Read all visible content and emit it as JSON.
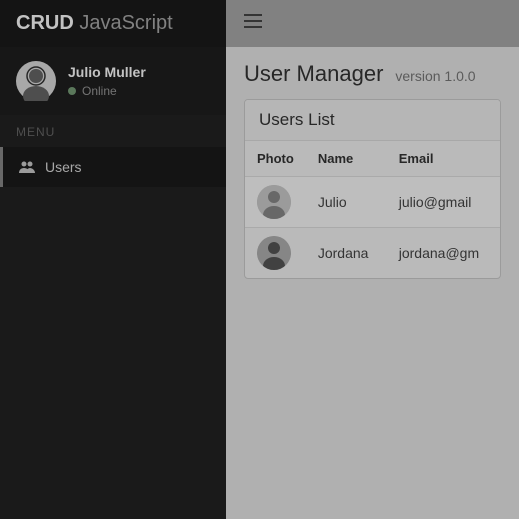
{
  "brand": {
    "bold": "CRUD",
    "light": "JavaScript"
  },
  "user_panel": {
    "name": "Julio Muller",
    "status": "Online"
  },
  "menu": {
    "header": "MENU",
    "items": [
      {
        "label": "Users"
      }
    ]
  },
  "page": {
    "title": "User Manager",
    "version": "version 1.0.0"
  },
  "panel": {
    "title": "Users List"
  },
  "table": {
    "headers": {
      "photo": "Photo",
      "name": "Name",
      "email": "Email"
    },
    "rows": [
      {
        "name": "Julio",
        "email": "julio@gmail"
      },
      {
        "name": "Jordana",
        "email": "jordana@gm"
      }
    ]
  }
}
